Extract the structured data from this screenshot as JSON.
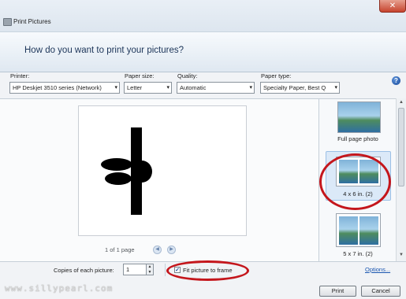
{
  "window": {
    "title": "Print Pictures",
    "close_glyph": "✕"
  },
  "header": {
    "heading": "How do you want to print your pictures?"
  },
  "options": {
    "printer_label": "Printer:",
    "printer_value": "HP Deskjet 3510 series (Network)",
    "paper_size_label": "Paper size:",
    "paper_size_value": "Letter",
    "quality_label": "Quality:",
    "quality_value": "Automatic",
    "paper_type_label": "Paper type:",
    "paper_type_value": "Specialty Paper, Best Q",
    "dropdown_glyph": "▾",
    "help_glyph": "?"
  },
  "preview": {
    "page_indicator": "1 of 1 page",
    "prev_glyph": "◀",
    "next_glyph": "▶"
  },
  "layouts": {
    "items": [
      {
        "label": "Full page photo",
        "selected": false
      },
      {
        "label": "4 x 6 in. (2)",
        "selected": true
      },
      {
        "label": "5 x 7 in. (2)",
        "selected": false
      }
    ],
    "scroll_up_glyph": "▲",
    "scroll_down_glyph": "▼"
  },
  "footer": {
    "copies_label": "Copies of each picture:",
    "copies_value": "1",
    "spin_up": "▲",
    "spin_down": "▼",
    "fit_checkbox_checked": true,
    "check_glyph": "✓",
    "fit_label": "Fit picture to frame",
    "options_link": "Options...",
    "print_button": "Print",
    "cancel_button": "Cancel"
  },
  "watermark": "www.sillypearl.com",
  "colors": {
    "annotation_red": "#c4161c",
    "heading_blue": "#1c3559",
    "link_blue": "#1a56b0",
    "selection_blue": "#dbe9f8"
  }
}
